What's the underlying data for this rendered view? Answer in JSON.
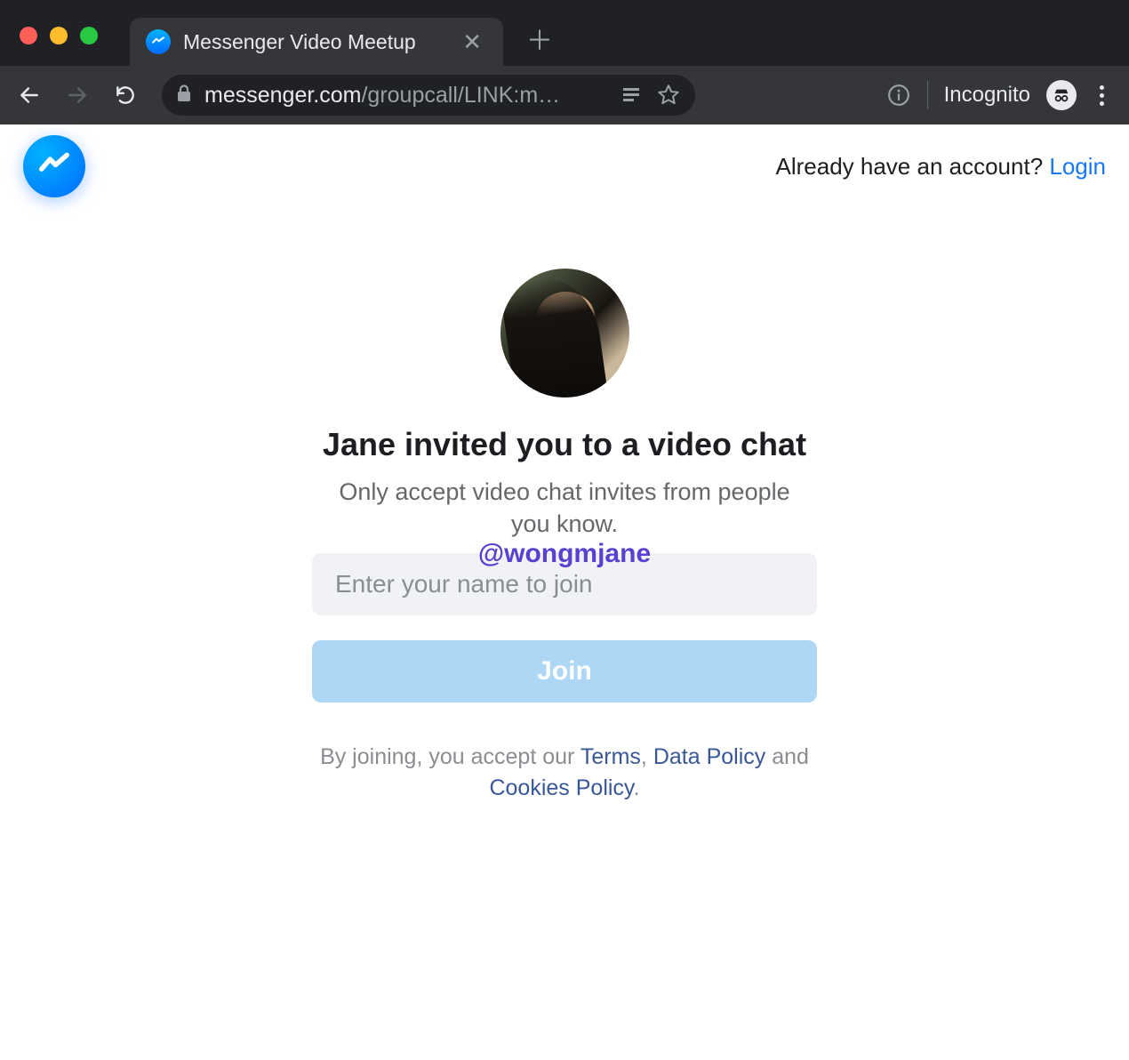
{
  "browser": {
    "tab_title": "Messenger Video Meetup",
    "url_host": "messenger.com",
    "url_path": "/groupcall/LINK:m…",
    "incognito_label": "Incognito"
  },
  "header": {
    "account_prompt": "Already have an account? ",
    "login_text": "Login"
  },
  "main": {
    "headline": "Jane invited you to a video chat",
    "subhead": "Only accept video chat invites from people you know.",
    "watermark": "@wongmjane",
    "name_placeholder": "Enter your name to join",
    "join_label": "Join"
  },
  "legal": {
    "prefix": "By joining, you accept our ",
    "terms": "Terms",
    "sep1": ", ",
    "data_policy": "Data Policy",
    "sep2": " and ",
    "cookies": "Cookies Policy",
    "suffix": "."
  }
}
